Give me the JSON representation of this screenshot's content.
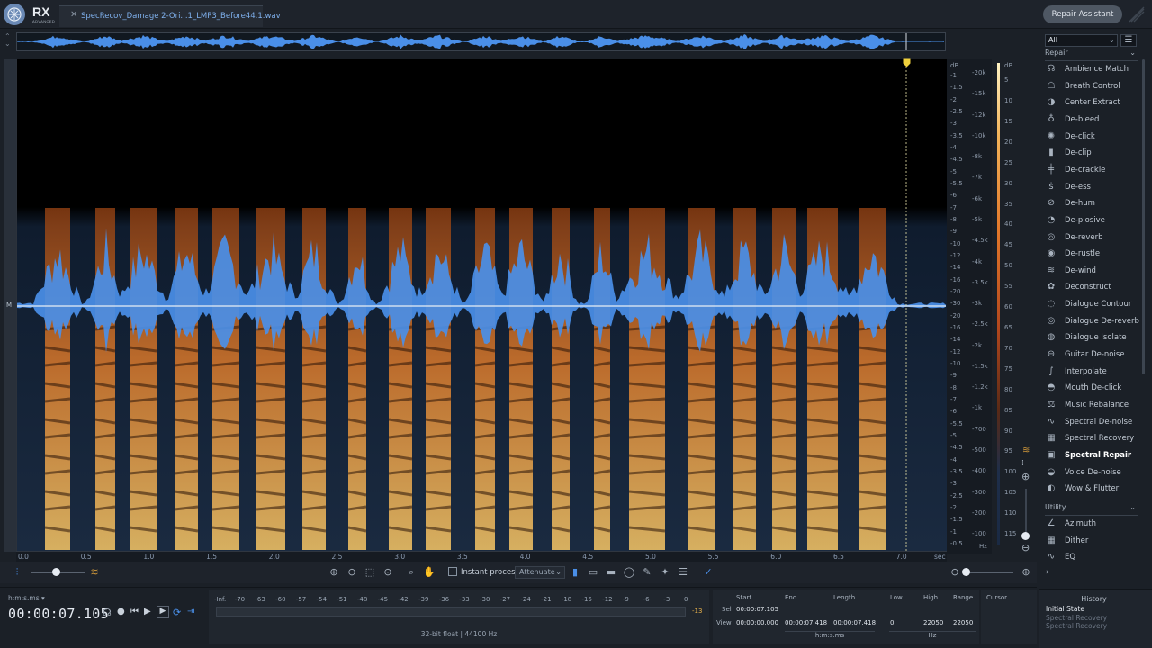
{
  "app": {
    "logo": "RX",
    "logo_sub": "ADVANCED"
  },
  "tabs": [
    {
      "label": "SpecRecov_Damage 2-Ori...1_LMP3_Before44.1.wav",
      "close": "✕"
    }
  ],
  "header": {
    "repair_assistant_label": "Repair Assistant"
  },
  "editor": {
    "channel_label": "M",
    "time_labels": [
      "0.0",
      "0.5",
      "1.0",
      "1.5",
      "2.0",
      "2.5",
      "3.0",
      "3.5",
      "4.0",
      "4.5",
      "5.0",
      "5.5",
      "6.0",
      "6.5",
      "7.0"
    ],
    "time_unit": "sec",
    "playhead_sec": 7.105,
    "db_scale_title": "dB",
    "db_scale_labels": [
      "-1",
      "-1.5",
      "-2",
      "-2.5",
      "-3",
      "-3.5",
      "-4",
      "-4.5",
      "-5",
      "-5.5",
      "-6",
      "-7",
      "-8",
      "-9",
      "-10",
      "-12",
      "-14",
      "-16",
      "-20",
      "-30",
      "-20",
      "-16",
      "-14",
      "-12",
      "-10",
      "-9",
      "-8",
      "-7",
      "-6",
      "-5.5",
      "-5",
      "-4.5",
      "-4",
      "-3.5",
      "-3",
      "-2.5",
      "-2",
      "-1.5",
      "-1",
      "-0.5"
    ],
    "hz_scale_labels": [
      "-20k",
      "-15k",
      "-12k",
      "-10k",
      "-8k",
      "-7k",
      "-6k",
      "-5k",
      "-4.5k",
      "-4k",
      "-3.5k",
      "-3k",
      "-2.5k",
      "-2k",
      "-1.5k",
      "-1.2k",
      "-1k",
      "-700",
      "-500",
      "-400",
      "-300",
      "-200",
      "-100"
    ],
    "hz_unit": "Hz",
    "colorbar_title": "dB",
    "colorbar_labels": [
      "5",
      "10",
      "15",
      "20",
      "25",
      "30",
      "35",
      "40",
      "45",
      "50",
      "55",
      "60",
      "65",
      "70",
      "75",
      "80",
      "85",
      "90",
      "95",
      "100",
      "105",
      "110",
      "115"
    ]
  },
  "toolbar": {
    "instant_process_label": "Instant process",
    "mode_value": "Attenuate"
  },
  "transport": {
    "time_format": "h:m:s.ms",
    "timecode": "00:00:07.105"
  },
  "meter": {
    "ticks": [
      "-Inf.",
      "-70",
      "-63",
      "-60",
      "-57",
      "-54",
      "-51",
      "-48",
      "-45",
      "-42",
      "-39",
      "-36",
      "-33",
      "-30",
      "-27",
      "-24",
      "-21",
      "-18",
      "-15",
      "-12",
      "-9",
      "-6",
      "-3",
      "0"
    ],
    "peak_hold": "-13",
    "format_label": "32-bit float | 44100 Hz"
  },
  "selection": {
    "headers": {
      "start": "Start",
      "end": "End",
      "length": "Length",
      "low": "Low",
      "high": "High",
      "range": "Range",
      "cursor": "Cursor"
    },
    "sel_label": "Sel",
    "view_label": "View",
    "sel_start": "00:00:07.105",
    "view_start": "00:00:00.000",
    "view_end": "00:00:07.418",
    "view_length": "00:00:07.418",
    "low": "0",
    "high": "22050",
    "range": "22050",
    "time_unit": "h:m:s.ms",
    "freq_unit": "Hz"
  },
  "modules": {
    "filter": "All",
    "repair_header": "Repair",
    "repair_items": [
      {
        "label": "Ambience Match",
        "icon": "ambience-match-icon",
        "glyph": "☊"
      },
      {
        "label": "Breath Control",
        "icon": "breath-control-icon",
        "glyph": "☖"
      },
      {
        "label": "Center Extract",
        "icon": "center-extract-icon",
        "glyph": "◑"
      },
      {
        "label": "De-bleed",
        "icon": "de-bleed-icon",
        "glyph": "♁"
      },
      {
        "label": "De-click",
        "icon": "de-click-icon",
        "glyph": "✺"
      },
      {
        "label": "De-clip",
        "icon": "de-clip-icon",
        "glyph": "▮"
      },
      {
        "label": "De-crackle",
        "icon": "de-crackle-icon",
        "glyph": "╪"
      },
      {
        "label": "De-ess",
        "icon": "de-ess-icon",
        "glyph": "ṡ"
      },
      {
        "label": "De-hum",
        "icon": "de-hum-icon",
        "glyph": "⊘"
      },
      {
        "label": "De-plosive",
        "icon": "de-plosive-icon",
        "glyph": "◔"
      },
      {
        "label": "De-reverb",
        "icon": "de-reverb-icon",
        "glyph": "◎"
      },
      {
        "label": "De-rustle",
        "icon": "de-rustle-icon",
        "glyph": "◉"
      },
      {
        "label": "De-wind",
        "icon": "de-wind-icon",
        "glyph": "≋"
      },
      {
        "label": "Deconstruct",
        "icon": "deconstruct-icon",
        "glyph": "✿"
      },
      {
        "label": "Dialogue Contour",
        "icon": "dialogue-contour-icon",
        "glyph": "◌"
      },
      {
        "label": "Dialogue De-reverb",
        "icon": "dialogue-de-reverb-icon",
        "glyph": "◎"
      },
      {
        "label": "Dialogue Isolate",
        "icon": "dialogue-isolate-icon",
        "glyph": "◍"
      },
      {
        "label": "Guitar De-noise",
        "icon": "guitar-de-noise-icon",
        "glyph": "⊖"
      },
      {
        "label": "Interpolate",
        "icon": "interpolate-icon",
        "glyph": "∫"
      },
      {
        "label": "Mouth De-click",
        "icon": "mouth-de-click-icon",
        "glyph": "◓"
      },
      {
        "label": "Music Rebalance",
        "icon": "music-rebalance-icon",
        "glyph": "⚖"
      },
      {
        "label": "Spectral De-noise",
        "icon": "spectral-de-noise-icon",
        "glyph": "∿"
      },
      {
        "label": "Spectral Recovery",
        "icon": "spectral-recovery-icon",
        "glyph": "▦"
      },
      {
        "label": "Spectral Repair",
        "icon": "spectral-repair-icon",
        "glyph": "▣"
      },
      {
        "label": "Voice De-noise",
        "icon": "voice-de-noise-icon",
        "glyph": "◒"
      },
      {
        "label": "Wow & Flutter",
        "icon": "wow-flutter-icon",
        "glyph": "◐"
      }
    ],
    "active_item": "Spectral Repair",
    "utility_header": "Utility",
    "utility_items": [
      {
        "label": "Azimuth",
        "icon": "azimuth-icon",
        "glyph": "∠"
      },
      {
        "label": "Dither",
        "icon": "dither-icon",
        "glyph": "▦"
      },
      {
        "label": "EQ",
        "icon": "eq-icon",
        "glyph": "∿"
      }
    ]
  },
  "history": {
    "title": "History",
    "items": [
      "Initial State",
      "Spectral Recovery",
      "Spectral Recovery"
    ]
  },
  "colors": {
    "waveform": "#4a8fe8",
    "spectrum_hot": "#f2a43c",
    "background": "#1b2027",
    "accent": "#7fb0ec"
  }
}
